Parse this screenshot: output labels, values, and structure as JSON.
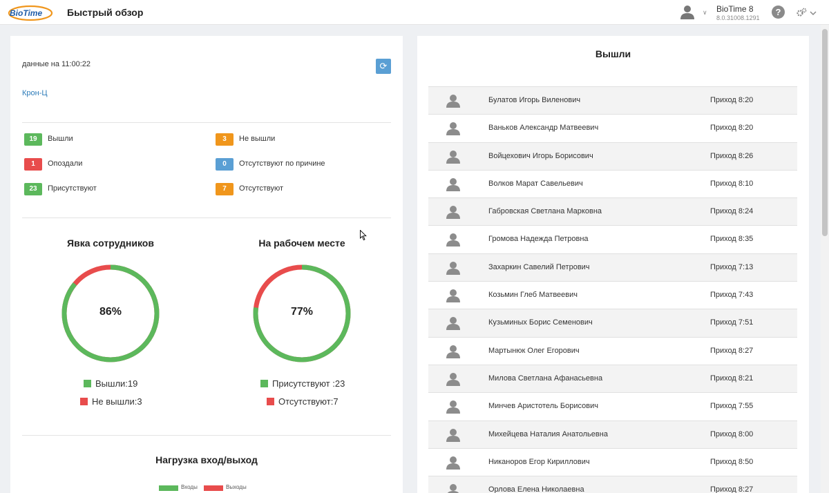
{
  "header": {
    "logo_text": "BioTime",
    "page_title": "Быстрый обзор",
    "app_name": "BioTime 8",
    "app_version": "8.0.31008.1291",
    "help_symbol": "?"
  },
  "overview": {
    "as_of": "данные на 11:00:22",
    "refresh_symbol": "⟳",
    "organization": "Крон-Ц",
    "stats": [
      {
        "count": "19",
        "label": "Вышли",
        "color": "#5cb85c"
      },
      {
        "count": "3",
        "label": "Не вышли",
        "color": "#f0961c"
      },
      {
        "count": "1",
        "label": "Опоздали",
        "color": "#e84c4c"
      },
      {
        "count": "0",
        "label": "Отсутствуют по причине",
        "color": "#5a9fd4"
      },
      {
        "count": "23",
        "label": "Присутствуют",
        "color": "#5cb85c"
      },
      {
        "count": "7",
        "label": "Отсутствуют",
        "color": "#f0961c"
      }
    ]
  },
  "charts": {
    "attendance": {
      "title": "Явка сотрудников",
      "percent": "86%",
      "fraction": 0.86,
      "legend": [
        {
          "label": "Вышли:19",
          "color": "#5cb85c"
        },
        {
          "label": "Не вышли:3",
          "color": "#e84c4c"
        }
      ]
    },
    "at_workplace": {
      "title": "На рабочем месте",
      "percent": "77%",
      "fraction": 0.77,
      "legend": [
        {
          "label": "Присутствуют :23",
          "color": "#5cb85c"
        },
        {
          "label": "Отсутствуют:7",
          "color": "#e84c4c"
        }
      ]
    }
  },
  "load": {
    "title": "Нагрузка вход/выход",
    "legend": [
      {
        "label": "Входы",
        "color": "#5cb85c"
      },
      {
        "label": "Выходы",
        "color": "#e84c4c"
      }
    ]
  },
  "arrived": {
    "title": "Вышли",
    "employees": [
      {
        "name": "Булатов Игорь Виленович",
        "time": "Приход 8:20"
      },
      {
        "name": "Ваньков Александр Матвеевич",
        "time": "Приход 8:20"
      },
      {
        "name": "Войцехович Игорь Борисович",
        "time": "Приход 8:26"
      },
      {
        "name": "Волков Марат Савельевич",
        "time": "Приход 8:10"
      },
      {
        "name": "Габровская Светлана Марковна",
        "time": "Приход 8:24"
      },
      {
        "name": "Громова Надежда Петровна",
        "time": "Приход 8:35"
      },
      {
        "name": "Захаркин Савелий Петрович",
        "time": "Приход 7:13"
      },
      {
        "name": "Козьмин Глеб Матвеевич",
        "time": "Приход 7:43"
      },
      {
        "name": "Кузьминых Борис Семенович",
        "time": "Приход 7:51"
      },
      {
        "name": "Мартынюк Олег Егорович",
        "time": "Приход 8:27"
      },
      {
        "name": "Милова Светлана Афанасьевна",
        "time": "Приход 8:21"
      },
      {
        "name": "Минчев Аристотель Борисович",
        "time": "Приход 7:55"
      },
      {
        "name": "Михейцева Наталия Анатольевна",
        "time": "Приход 8:00"
      },
      {
        "name": "Никаноров Егор Кириллович",
        "time": "Приход 8:50"
      },
      {
        "name": "Орлова Елена Николаевна",
        "time": "Приход 8:27"
      }
    ]
  }
}
